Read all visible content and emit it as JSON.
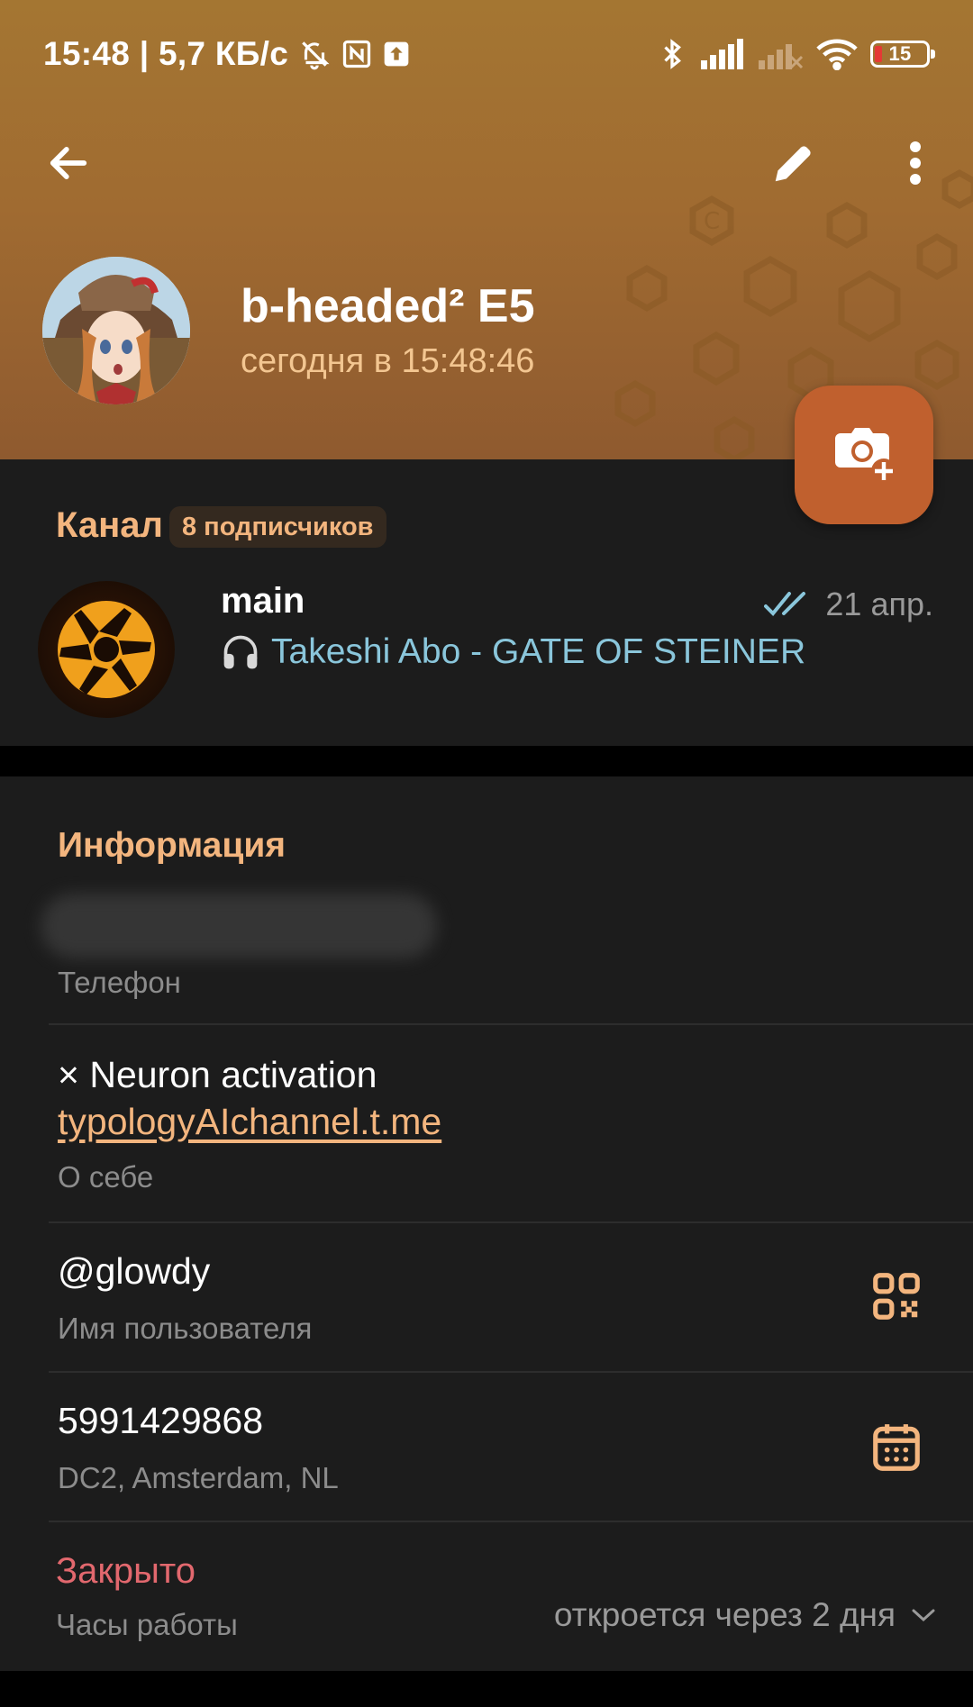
{
  "status_bar": {
    "time_speed": "15:48 | 5,7 КБ/с",
    "battery": "15"
  },
  "profile": {
    "name": "b-headed² E5",
    "last_seen": "сегодня в 15:48:46"
  },
  "channel": {
    "label": "Канал",
    "subscribers": "8 подписчиков",
    "title": "main",
    "date": "21 апр.",
    "message": "Takeshi Abo - GATE OF STEINER"
  },
  "info": {
    "title": "Информация",
    "phone_caption": "Телефон",
    "bio_line": "× Neuron activation",
    "bio_link": "typologyAIchannel.t.me",
    "bio_caption": "О себе",
    "username": "@glowdy",
    "username_caption": "Имя пользователя",
    "user_id": "5991429868",
    "dc_caption": "DC2, Amsterdam, NL",
    "hours_status": "Закрыто",
    "hours_caption": "Часы работы",
    "hours_opens": "откроется через 2 дня"
  },
  "colors": {
    "accent": "#f3b57e",
    "header_top": "#a47632",
    "header_bottom": "#8f5a2f",
    "card_bg": "#1c1c1c",
    "link_blue": "#8ac6db",
    "closed_red": "#e2686e",
    "fab": "#c0602e"
  },
  "icons": [
    "back-arrow-icon",
    "pencil-icon",
    "more-vert-icon",
    "camera-add-icon",
    "double-check-icon",
    "headphones-icon",
    "qr-code-icon",
    "calendar-icon",
    "chevron-down-icon"
  ]
}
